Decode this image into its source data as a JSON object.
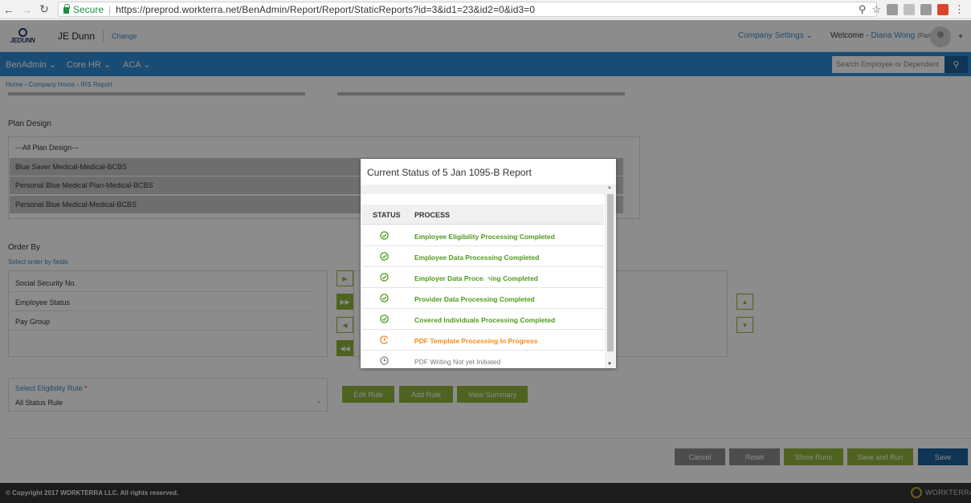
{
  "browser": {
    "secure_label": "Secure",
    "url": "https://preprod.workterra.net/BenAdmin/Report/Report/StaticReports?id=3&id1=23&id2=0&id3=0"
  },
  "header": {
    "company_name": "JE Dunn",
    "change_label": "Change",
    "company_settings_label": "Company Settings",
    "welcome_label": "Welcome -",
    "user_name": "Diana Wong",
    "user_role": "(Partner)",
    "logo_text": "JEDUNN"
  },
  "nav": {
    "items": [
      "BenAdmin",
      "Core HR",
      "ACA"
    ],
    "search_placeholder": "Search Employee or Dependent"
  },
  "breadcrumb": "Home  ›  Company Home  ›  IRS Report",
  "plan_design": {
    "label": "Plan Design",
    "options": [
      "---All Plan Design---",
      "Blue Saver Medical-Medical-BCBS",
      "Personal Blue Medical Plan-Medical-BCBS",
      "Personal Blue Medical-Medical-BCBS"
    ]
  },
  "order_by": {
    "label": "Order By",
    "sublabel": "Select order by fields",
    "fields": [
      "Social Security No.",
      "Employee Status",
      "Pay Group"
    ]
  },
  "eligibility": {
    "label": "Select Eligibility Rule",
    "required_mark": "*",
    "value": "All Status Rule"
  },
  "rule_buttons": {
    "edit": "Edit Rule",
    "add": "Add Rule",
    "view": "View Summary"
  },
  "action_buttons": {
    "cancel": "Cancel",
    "reset": "Reset",
    "show_runs": "Show Runs",
    "save_run": "Save and Run",
    "save": "Save"
  },
  "footer": {
    "copyright": "© Copyright 2017 WORKTERRA LLC. All rights reserved.",
    "powered_by": "WORKTERRA"
  },
  "modal": {
    "title": "Current Status of 5 Jan 1095-B Report",
    "headers": {
      "status": "STATUS",
      "process": "PROCESS"
    },
    "rows": [
      {
        "process": "Employee Eligibility Processing Completed",
        "status": "completed"
      },
      {
        "process": "Employee Data Processing Completed",
        "status": "completed"
      },
      {
        "process": "Employer Data Processing Completed",
        "status": "completed"
      },
      {
        "process": "Provider Data Processing Completed",
        "status": "completed"
      },
      {
        "process": "Covered Individuals Processing Completed",
        "status": "completed"
      },
      {
        "process": "PDF Template Processing In Progress",
        "status": "in-progress"
      },
      {
        "process": "PDF Writing Not yet Initiated",
        "status": "not-started"
      }
    ]
  },
  "colors": {
    "brand_blue": "#2f8ad4",
    "completed": "#4e9a1a",
    "in_progress": "#f28c1b",
    "button_green": "#8fb53a",
    "button_blue": "#1d5f99"
  }
}
